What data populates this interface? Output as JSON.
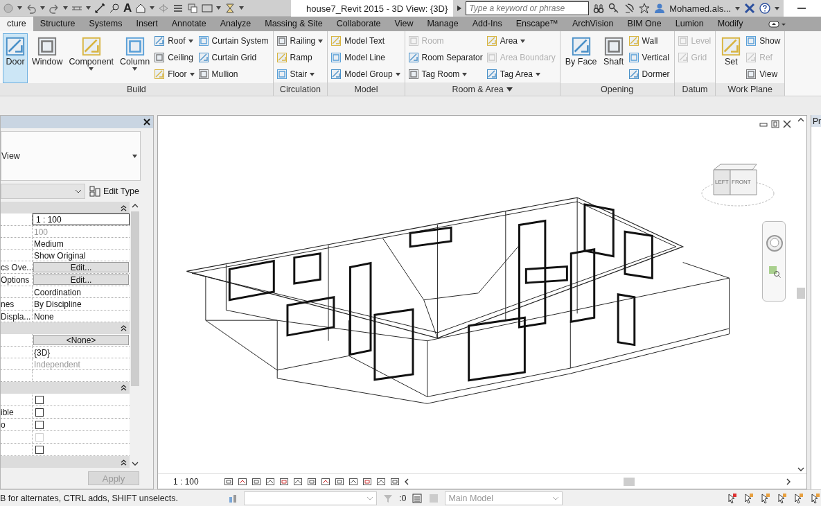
{
  "title_bar": {
    "text_glyph": "A",
    "title": "house7_Revit 2015 - 3D View: {3D}",
    "search": {
      "placeholder": "Type a keyword or phrase"
    },
    "user": "Mohamed.als..."
  },
  "tabs": [
    {
      "label": "cture",
      "selected": true
    },
    {
      "label": "Structure",
      "selected": false
    },
    {
      "label": "Systems",
      "selected": false
    },
    {
      "label": "Insert",
      "selected": false
    },
    {
      "label": "Annotate",
      "selected": false
    },
    {
      "label": "Analyze",
      "selected": false
    },
    {
      "label": "Massing & Site",
      "selected": false
    },
    {
      "label": "Collaborate",
      "selected": false
    },
    {
      "label": "View",
      "selected": false
    },
    {
      "label": "Manage",
      "selected": false
    },
    {
      "label": "Add-Ins",
      "selected": false
    },
    {
      "label": "Enscape™",
      "selected": false
    },
    {
      "label": "ArchVision",
      "selected": false
    },
    {
      "label": "BIM One",
      "selected": false
    },
    {
      "label": "Lumion",
      "selected": false
    },
    {
      "label": "Modify",
      "selected": false
    }
  ],
  "ribbon": {
    "panels": [
      {
        "label": "Build",
        "dropdown": false,
        "items": [
          {
            "label": "Door",
            "kind": "large",
            "selected": true,
            "dropdown": false,
            "disabled": false
          },
          {
            "label": "Window",
            "kind": "large",
            "selected": false,
            "dropdown": false,
            "disabled": false
          },
          {
            "label": "Component",
            "kind": "large",
            "selected": false,
            "dropdown": true,
            "disabled": false
          },
          {
            "label": "Column",
            "kind": "large",
            "selected": false,
            "dropdown": true,
            "disabled": false
          },
          {
            "label": "Roof",
            "kind": "small",
            "selected": false,
            "dropdown": true,
            "disabled": false
          },
          {
            "label": "Ceiling",
            "kind": "small",
            "selected": false,
            "dropdown": false,
            "disabled": false
          },
          {
            "label": "Floor",
            "kind": "small",
            "selected": false,
            "dropdown": true,
            "disabled": false
          },
          {
            "label": "Curtain System",
            "kind": "small",
            "selected": false,
            "dropdown": false,
            "disabled": false
          },
          {
            "label": "Curtain Grid",
            "kind": "small",
            "selected": false,
            "dropdown": false,
            "disabled": false
          },
          {
            "label": "Mullion",
            "kind": "small",
            "selected": false,
            "dropdown": false,
            "disabled": false
          }
        ]
      },
      {
        "label": "Circulation",
        "dropdown": false,
        "items": [
          {
            "label": "Railing",
            "kind": "small",
            "selected": false,
            "dropdown": true,
            "disabled": false
          },
          {
            "label": "Ramp",
            "kind": "small",
            "selected": false,
            "dropdown": false,
            "disabled": false
          },
          {
            "label": "Stair",
            "kind": "small",
            "selected": false,
            "dropdown": true,
            "disabled": false
          }
        ]
      },
      {
        "label": "Model",
        "dropdown": false,
        "items": [
          {
            "label": "Model Text",
            "kind": "small",
            "selected": false,
            "dropdown": false,
            "disabled": false
          },
          {
            "label": "Model Line",
            "kind": "small",
            "selected": false,
            "dropdown": false,
            "disabled": false
          },
          {
            "label": "Model Group",
            "kind": "small",
            "selected": false,
            "dropdown": true,
            "disabled": false
          }
        ]
      },
      {
        "label": "Room & Area",
        "dropdown": true,
        "items": [
          {
            "label": "Room",
            "kind": "small",
            "selected": false,
            "dropdown": false,
            "disabled": true
          },
          {
            "label": "Room Separator",
            "kind": "small",
            "selected": false,
            "dropdown": false,
            "disabled": false
          },
          {
            "label": "Tag Room",
            "kind": "small",
            "selected": false,
            "dropdown": true,
            "disabled": false
          },
          {
            "label": "Area",
            "kind": "small",
            "selected": false,
            "dropdown": true,
            "disabled": false
          },
          {
            "label": "Area Boundary",
            "kind": "small",
            "selected": false,
            "dropdown": false,
            "disabled": true
          },
          {
            "label": "Tag Area",
            "kind": "small",
            "selected": false,
            "dropdown": true,
            "disabled": false
          }
        ]
      },
      {
        "label": "Opening",
        "dropdown": false,
        "items": [
          {
            "label": "By Face",
            "kind": "large",
            "selected": false,
            "dropdown": false,
            "disabled": false
          },
          {
            "label": "Shaft",
            "kind": "large",
            "selected": false,
            "dropdown": false,
            "disabled": false
          },
          {
            "label": "Wall",
            "kind": "small",
            "selected": false,
            "dropdown": false,
            "disabled": false
          },
          {
            "label": "Vertical",
            "kind": "small",
            "selected": false,
            "dropdown": false,
            "disabled": false
          },
          {
            "label": "Dormer",
            "kind": "small",
            "selected": false,
            "dropdown": false,
            "disabled": false
          }
        ]
      },
      {
        "label": "Datum",
        "dropdown": false,
        "items": [
          {
            "label": "Level",
            "kind": "small",
            "selected": false,
            "dropdown": false,
            "disabled": true
          },
          {
            "label": "Grid",
            "kind": "small",
            "selected": false,
            "dropdown": false,
            "disabled": true
          }
        ]
      },
      {
        "label": "Work Plane",
        "dropdown": false,
        "items": [
          {
            "label": "Set",
            "kind": "large",
            "selected": false,
            "dropdown": false,
            "disabled": false
          },
          {
            "label": "Show",
            "kind": "small",
            "selected": false,
            "dropdown": false,
            "disabled": false
          },
          {
            "label": "Ref",
            "kind": "small",
            "selected": false,
            "dropdown": false,
            "disabled": true
          },
          {
            "label": "View",
            "kind": "small",
            "selected": false,
            "dropdown": false,
            "disabled": false
          }
        ]
      }
    ]
  },
  "properties": {
    "type_name": "View",
    "edit_type": "Edit Type",
    "sections": [
      {
        "expanded": true,
        "rows": [
          {
            "kind": "field",
            "value": "1 : 100"
          },
          {
            "kind": "text",
            "value": "100",
            "disabled": true
          },
          {
            "kind": "text",
            "value": "Medium",
            "disabled": false
          },
          {
            "kind": "text",
            "value": "Show Original",
            "disabled": false
          },
          {
            "kind": "button",
            "label": "cs Ove...",
            "value": "Edit..."
          },
          {
            "kind": "button",
            "label": "Options",
            "value": "Edit..."
          },
          {
            "kind": "text",
            "value": "Coordination",
            "disabled": false
          },
          {
            "kind": "text",
            "label": "nes",
            "value": "By Discipline",
            "disabled": false
          },
          {
            "kind": "text",
            "label": "Displa...",
            "value": "None",
            "disabled": false
          }
        ]
      },
      {
        "expanded": true,
        "rows": [
          {
            "kind": "button",
            "value": "<None>"
          },
          {
            "kind": "text",
            "value": "{3D}",
            "disabled": false
          },
          {
            "kind": "text",
            "value": "Independent",
            "disabled": true
          },
          {
            "kind": "empty"
          }
        ]
      },
      {
        "expanded": true,
        "rows": [
          {
            "kind": "checkbox",
            "checked": false,
            "disabled": false
          },
          {
            "kind": "checkbox",
            "label": "ible",
            "checked": false,
            "disabled": false
          },
          {
            "kind": "checkbox",
            "label": "o",
            "checked": false,
            "disabled": false
          },
          {
            "kind": "checkbox",
            "checked": false,
            "disabled": true
          },
          {
            "kind": "checkbox",
            "checked": false,
            "disabled": false
          }
        ]
      },
      {
        "expanded": true
      }
    ],
    "apply": {
      "label": "Apply",
      "disabled": true
    }
  },
  "viewport": {
    "viewcube_faces": [
      "LEFT",
      "FRONT"
    ],
    "scale": "1 : 100"
  },
  "project_browser": {
    "tab": "Pr"
  },
  "status_bar": {
    "hint": "B for alternates, CTRL adds, SHIFT unselects.",
    "filter_count": ":0",
    "model": "Main Model"
  }
}
